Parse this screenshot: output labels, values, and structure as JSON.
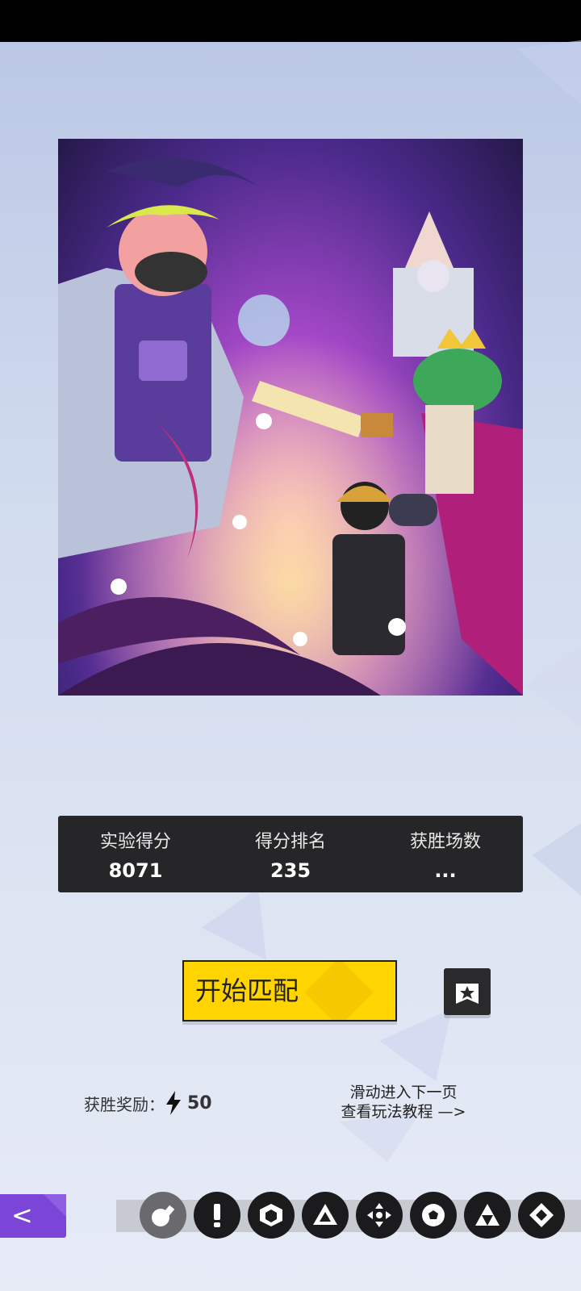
{
  "stats": [
    {
      "label": "实验得分",
      "value": "8071"
    },
    {
      "label": "得分排名",
      "value": "235"
    },
    {
      "label": "获胜场数",
      "value": "..."
    }
  ],
  "start_button": {
    "label": "开始匹配"
  },
  "reward": {
    "label": "获胜奖励：",
    "amount": "50",
    "icon": "lightning-icon"
  },
  "hint": {
    "line1": "滑动进入下一页",
    "line2": "查看玩法教程 —>"
  },
  "back_button": {
    "label": "<"
  },
  "modes": [
    {
      "icon": "bomb-icon",
      "active": true
    },
    {
      "icon": "exclamation-icon",
      "active": false
    },
    {
      "icon": "cube-icon",
      "active": false
    },
    {
      "icon": "triangle-arrows-icon",
      "active": false
    },
    {
      "icon": "move-arrows-icon",
      "active": false
    },
    {
      "icon": "soccer-ball-icon",
      "active": false
    },
    {
      "icon": "triforce-icon",
      "active": false
    },
    {
      "icon": "diamond-pattern-icon",
      "active": false
    }
  ],
  "colors": {
    "accent_yellow": "#ffd400",
    "back_purple": "#7b45d8",
    "panel_dark": "#262628"
  }
}
